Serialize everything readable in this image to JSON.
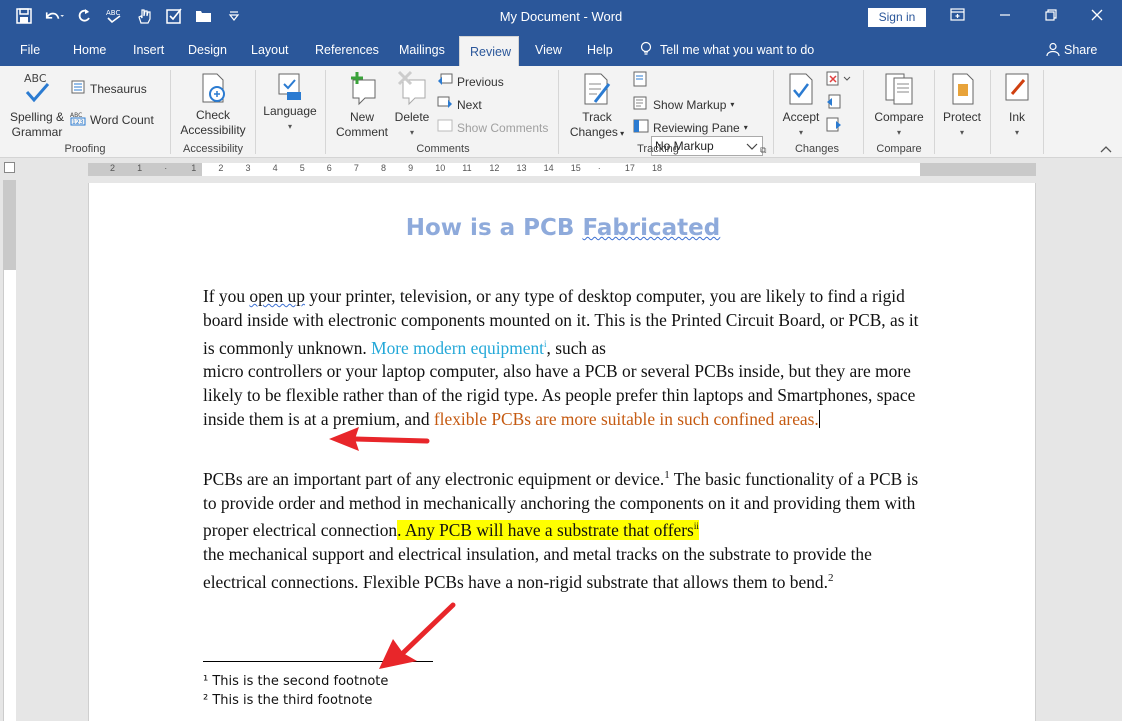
{
  "titlebar": {
    "document_title": "My Document  -  Word",
    "sign_in": "Sign in",
    "qat_icons": [
      "save-icon",
      "undo-icon",
      "redo-icon",
      "spelling-check-icon",
      "touch-mode-icon",
      "checkbox-icon",
      "folder-icon",
      "customize-icon"
    ],
    "window_controls": [
      "ribbon-display-icon",
      "minimize-icon",
      "restore-icon",
      "close-icon"
    ]
  },
  "tabs": [
    "File",
    "Home",
    "Insert",
    "Design",
    "Layout",
    "References",
    "Mailings",
    "Review",
    "View",
    "Help"
  ],
  "active_tab": "Review",
  "tell_me": "Tell me what you want to do",
  "share": "Share",
  "ribbon": {
    "proofing": {
      "spelling_line1": "Spelling &",
      "spelling_line2": "Grammar",
      "thesaurus": "Thesaurus",
      "word_count": "Word Count",
      "label": "Proofing"
    },
    "accessibility": {
      "check_line1": "Check",
      "check_line2": "Accessibility",
      "label": "Accessibility"
    },
    "language": {
      "button": "Language"
    },
    "comments": {
      "new_line1": "New",
      "new_line2": "Comment",
      "delete": "Delete",
      "previous": "Previous",
      "next": "Next",
      "show_comments": "Show Comments",
      "label": "Comments"
    },
    "tracking": {
      "track_line1": "Track",
      "track_line2": "Changes",
      "markup_value": "No Markup",
      "show_markup": "Show Markup",
      "reviewing_pane": "Reviewing Pane",
      "label": "Tracking"
    },
    "changes": {
      "accept": "Accept",
      "label": "Changes"
    },
    "compare": {
      "compare": "Compare",
      "label": "Compare"
    },
    "protect": {
      "button": "Protect"
    },
    "ink": {
      "button": "Ink"
    }
  },
  "ruler": {
    "numbers": [
      "2",
      "1",
      "",
      "1",
      "2",
      "3",
      "4",
      "5",
      "6",
      "7",
      "8",
      "9",
      "10",
      "11",
      "12",
      "13",
      "14",
      "15",
      "",
      "17",
      "18"
    ]
  },
  "document": {
    "heading_part1": "How is a PCB ",
    "heading_part2": "Fabricated",
    "p1_a": "If you ",
    "p1_b": "open up",
    "p1_c": " your printer, television, or any type of desktop computer, you are likely to find a rigid board inside with electronic components mounted on it. This is the Printed Circuit Board, or PCB, as it is commonly unknown. ",
    "p1_blue": "More modern equipment",
    "p1_blue_sup": "i",
    "p1_d": ", such as",
    "p1_e": "micro controllers or your laptop computer, also have a PCB or several PCBs inside, but they are more likely to be flexible rather than of the rigid type. As people prefer thin laptops and Smartphones, space inside them is at a premium, and ",
    "p1_orange": "flexible PCBs are more suitable in such confined areas.",
    "p2_a": "PCBs are an important part of any electronic equipment or device.",
    "p2_sup1": "1",
    "p2_b": " The basic functionality of a PCB is to provide order and method in mechanically anchoring the components on it and providing them with proper electrical connection",
    "p2_hl": ". Any PCB will have a substrate that offers",
    "p2_hl_sup": "ii",
    "p2_c": "the mechanical support and electrical insulation, and metal tracks on the substrate to provide the electrical connections. Flexible PCBs have a non-rigid substrate that allows them to bend.",
    "p2_sup2": "2",
    "footnote1": "¹ This is the second footnote",
    "footnote2": "² This is the third footnote"
  },
  "colors": {
    "title_bar": "#2b579a",
    "heading": "#8eaadb",
    "blue_text": "#24a8d8",
    "orange_text": "#c55a11",
    "highlight": "#ffff00",
    "arrow": "#e8262a"
  }
}
